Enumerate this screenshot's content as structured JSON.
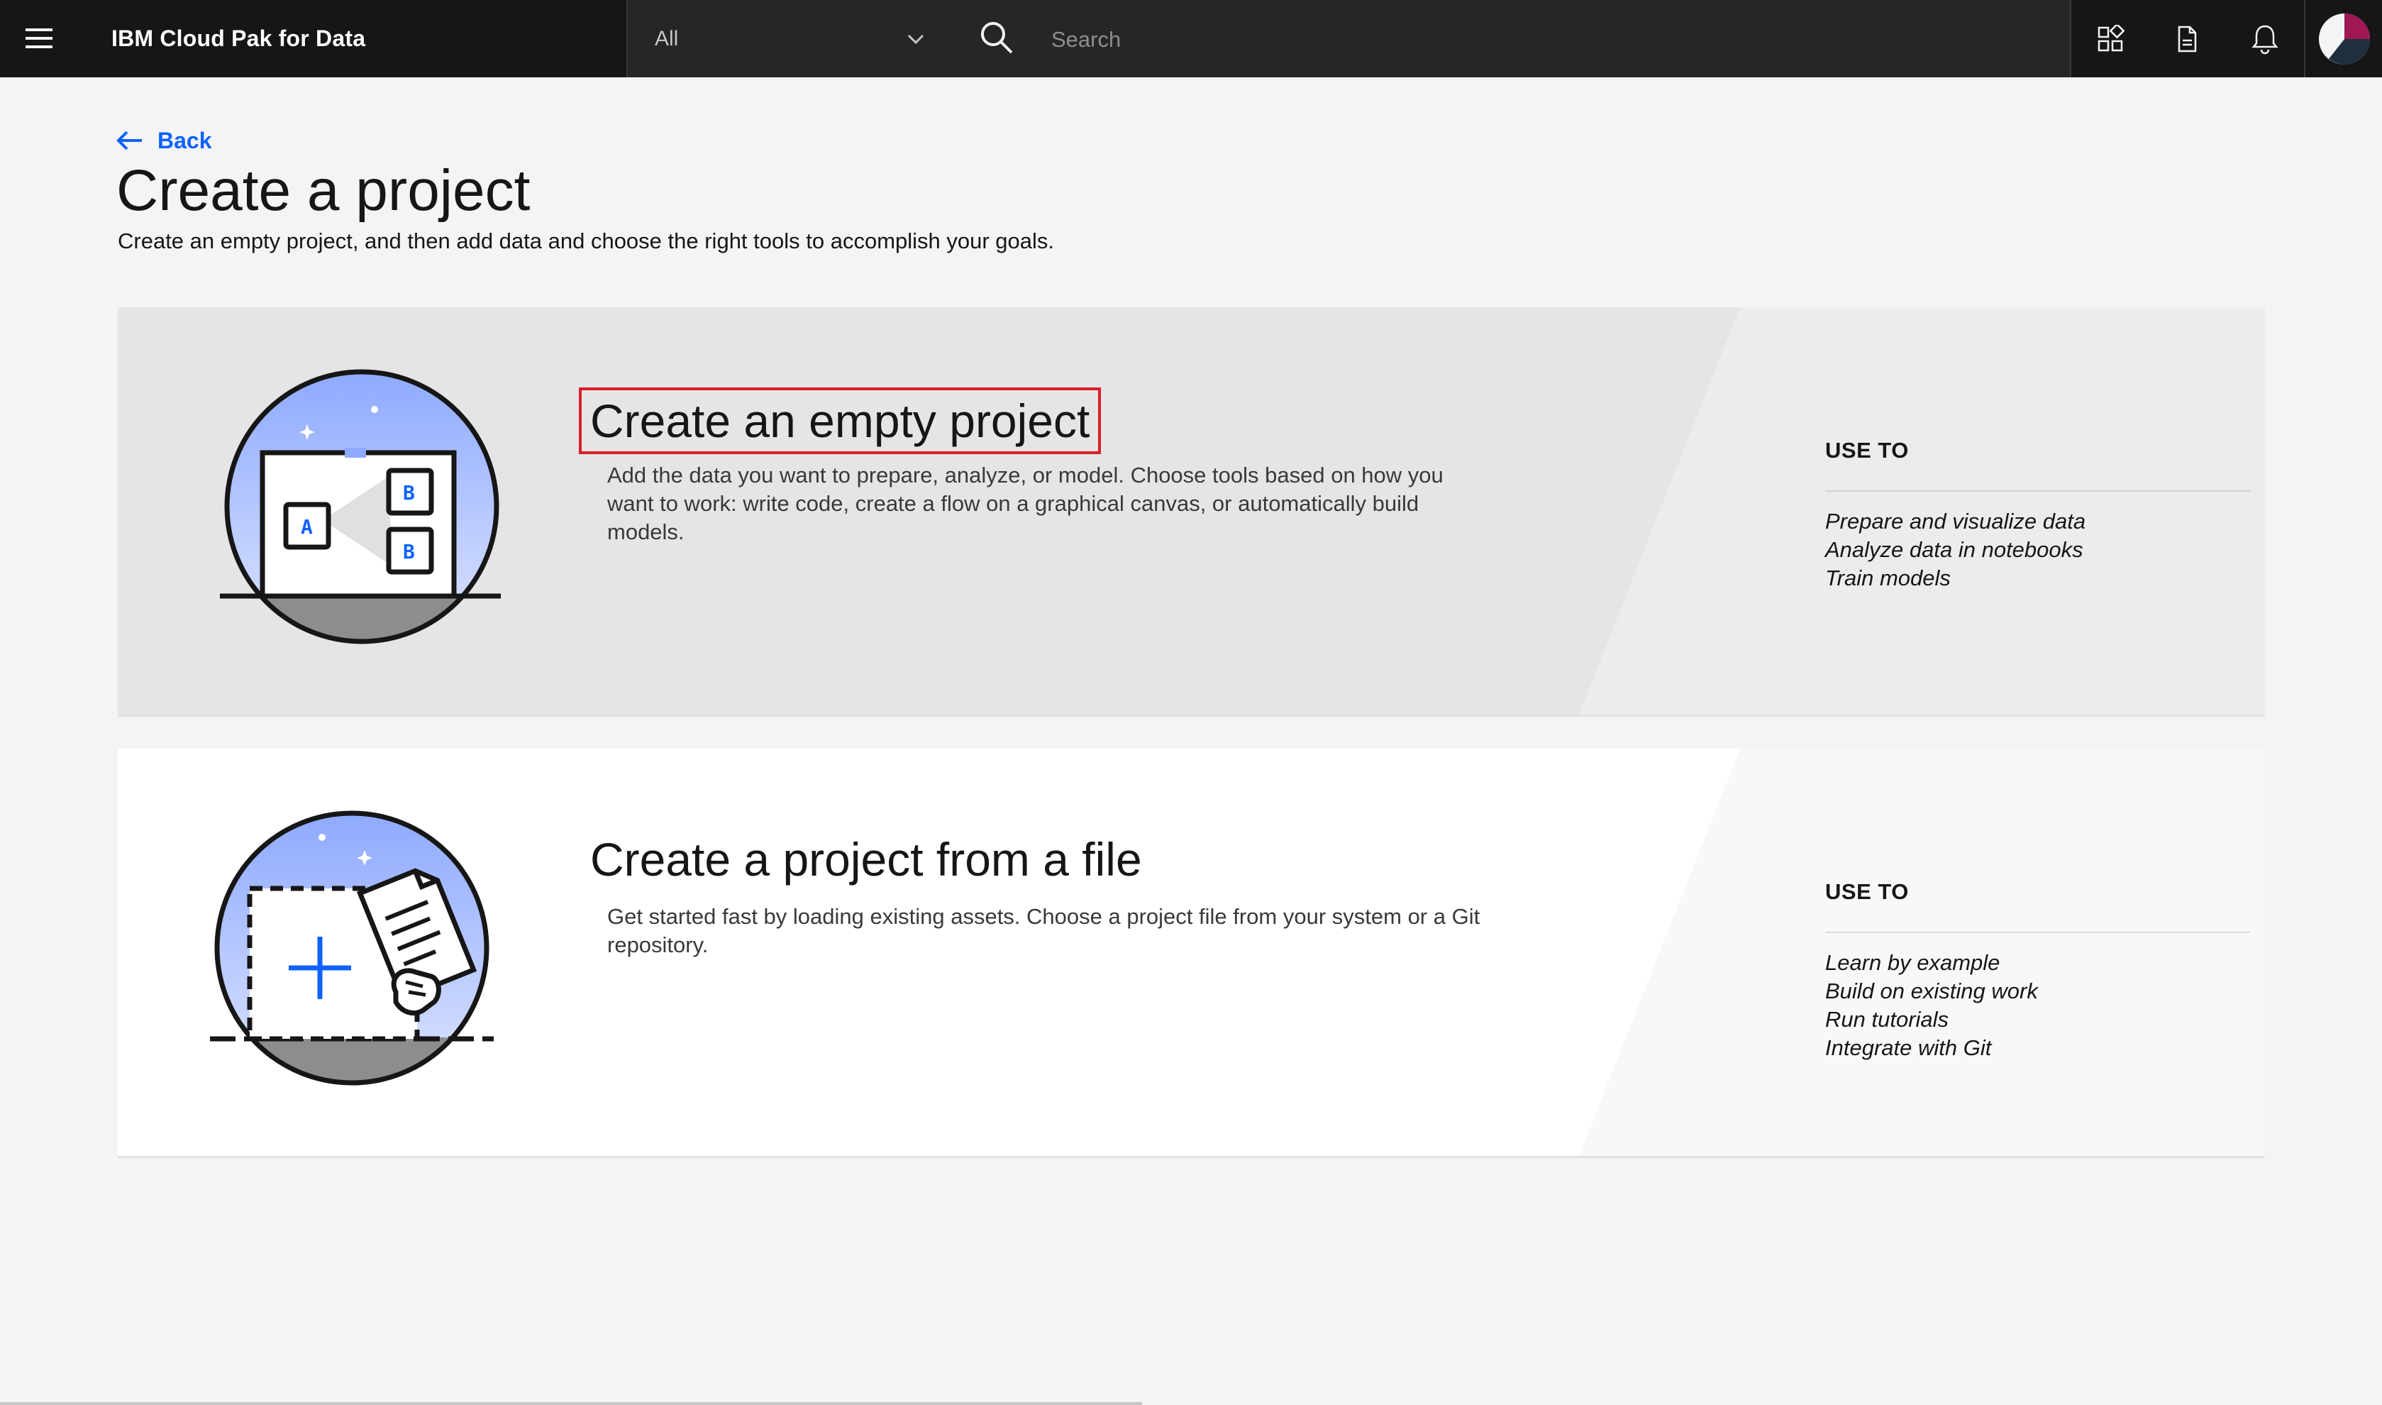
{
  "topbar": {
    "brand": "IBM Cloud Pak for Data",
    "scope_selected": "All",
    "search_placeholder": "Search",
    "icons": [
      "menu-icon",
      "chevron-down-icon",
      "search-icon",
      "catalog-icon",
      "document-icon",
      "notification-icon",
      "avatar"
    ]
  },
  "header": {
    "back_label": "Back",
    "title": "Create a project",
    "description": "Create an empty project, and then add data and choose the right tools to accomplish your goals."
  },
  "cards": [
    {
      "title": "Create an empty project",
      "description": "Add the data you want to prepare, analyze, or model. Choose tools based on how you want to work: write code, create a flow on a graphical canvas, or automatically build models.",
      "use_to_heading": "USE TO",
      "use_to": [
        "Prepare and visualize data",
        "Analyze data in notebooks",
        "Train models"
      ],
      "icon": "ab-test-illustration"
    },
    {
      "title": "Create a project from a file",
      "description": "Get started fast by loading existing assets. Choose a project file from your system or a Git repository.",
      "use_to_heading": "USE TO",
      "use_to": [
        "Learn by example",
        "Build on existing work",
        "Run tutorials",
        "Integrate with Git"
      ],
      "icon": "upload-file-illustration"
    }
  ],
  "colors": {
    "topbar": "#161616",
    "link": "#0f62fe",
    "highlight": "#da1e28",
    "card_selected": "#e5e5e5",
    "card": "#ffffff"
  }
}
